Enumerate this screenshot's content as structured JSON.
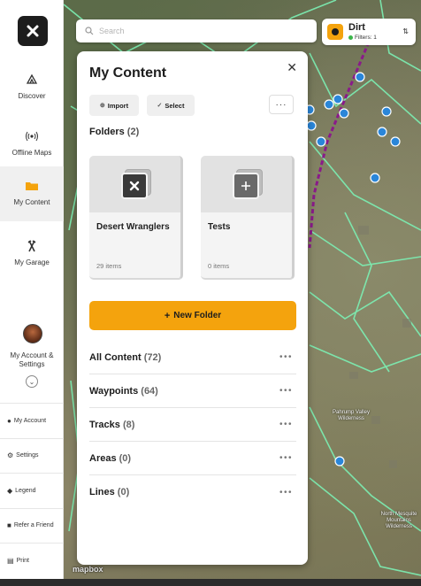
{
  "search": {
    "placeholder": "Search"
  },
  "map_chip": {
    "title": "Dirt",
    "filters": "Filters: 1"
  },
  "sidebar": {
    "items": [
      {
        "label": "Discover",
        "icon": "discover-icon"
      },
      {
        "label": "Offline Maps",
        "icon": "offline-maps-icon"
      },
      {
        "label": "My Content",
        "icon": "folder-icon",
        "active": true
      },
      {
        "label": "My Garage",
        "icon": "garage-icon"
      }
    ],
    "account_label": "My Account & Settings",
    "bottom_links": [
      {
        "label": "My Account",
        "icon": "person-icon"
      },
      {
        "label": "Settings",
        "icon": "gear-icon"
      },
      {
        "label": "Legend",
        "icon": "legend-icon"
      },
      {
        "label": "Refer a Friend",
        "icon": "people-icon"
      },
      {
        "label": "Print",
        "icon": "print-icon"
      }
    ]
  },
  "panel": {
    "title": "My Content",
    "import_label": "Import",
    "select_label": "Select",
    "folders_title": "Folders",
    "folders_count": "(2)",
    "folders": [
      {
        "name": "Desert Wranglers",
        "count": "29 items",
        "icon": "x-logo-icon"
      },
      {
        "name": "Tests",
        "count": "0 items",
        "icon": "plus-icon"
      }
    ],
    "new_folder_label": "New Folder",
    "rows": [
      {
        "label": "All Content",
        "count": "(72)"
      },
      {
        "label": "Waypoints",
        "count": "(64)"
      },
      {
        "label": "Tracks",
        "count": "(8)"
      },
      {
        "label": "Areas",
        "count": "(0)"
      },
      {
        "label": "Lines",
        "count": "(0)"
      }
    ]
  },
  "map_labels": {
    "pahrump": "Pahrump Valley Wilderness",
    "north": "North Mesquite Mountains Wilderness",
    "mapbox": "mapbox"
  },
  "colors": {
    "accent": "#f4a30d",
    "trail": "#7cf0b4",
    "boundary": "#8a1a8a",
    "waypoint": "#2a86d9"
  }
}
